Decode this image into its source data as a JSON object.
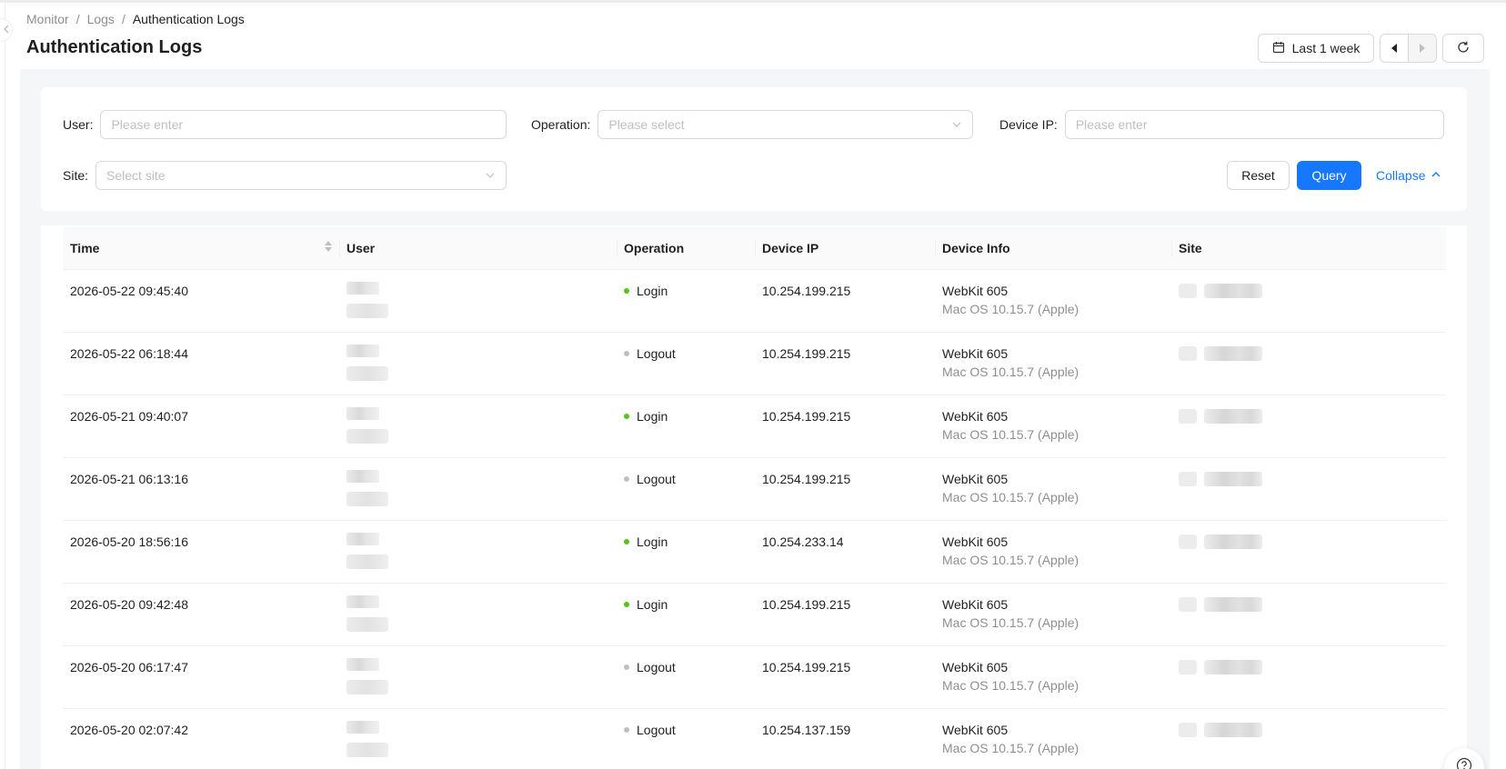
{
  "breadcrumb": {
    "items": [
      "Monitor",
      "Logs",
      "Authentication Logs"
    ],
    "separator": "/"
  },
  "page": {
    "title": "Authentication Logs"
  },
  "toolbar": {
    "range_label": "Last 1 week",
    "icons": [
      "calendar-icon",
      "caret-left-icon",
      "caret-right-icon",
      "reload-icon"
    ]
  },
  "filters": {
    "user": {
      "label": "User",
      "placeholder": "Please enter"
    },
    "operation": {
      "label": "Operation",
      "placeholder": "Please select"
    },
    "device_ip": {
      "label": "Device IP",
      "placeholder": "Please enter"
    },
    "site": {
      "label": "Site",
      "placeholder": "Select site"
    },
    "reset_label": "Reset",
    "query_label": "Query",
    "collapse_label": "Collapse"
  },
  "table": {
    "columns": {
      "time": "Time",
      "user": "User",
      "operation": "Operation",
      "device_ip": "Device IP",
      "device_info": "Device Info",
      "site": "Site"
    },
    "rows": [
      {
        "time": "2026-05-22 09:45:40",
        "operation": "Login",
        "device_ip": "10.254.199.215",
        "device_name": "WebKit 605",
        "device_os": "Mac OS 10.15.7 (Apple)"
      },
      {
        "time": "2026-05-22 06:18:44",
        "operation": "Logout",
        "device_ip": "10.254.199.215",
        "device_name": "WebKit 605",
        "device_os": "Mac OS 10.15.7 (Apple)"
      },
      {
        "time": "2026-05-21 09:40:07",
        "operation": "Login",
        "device_ip": "10.254.199.215",
        "device_name": "WebKit 605",
        "device_os": "Mac OS 10.15.7 (Apple)"
      },
      {
        "time": "2026-05-21 06:13:16",
        "operation": "Logout",
        "device_ip": "10.254.199.215",
        "device_name": "WebKit 605",
        "device_os": "Mac OS 10.15.7 (Apple)"
      },
      {
        "time": "2026-05-20 18:56:16",
        "operation": "Login",
        "device_ip": "10.254.233.14",
        "device_name": "WebKit 605",
        "device_os": "Mac OS 10.15.7 (Apple)"
      },
      {
        "time": "2026-05-20 09:42:48",
        "operation": "Login",
        "device_ip": "10.254.199.215",
        "device_name": "WebKit 605",
        "device_os": "Mac OS 10.15.7 (Apple)"
      },
      {
        "time": "2026-05-20 06:17:47",
        "operation": "Logout",
        "device_ip": "10.254.199.215",
        "device_name": "WebKit 605",
        "device_os": "Mac OS 10.15.7 (Apple)"
      },
      {
        "time": "2026-05-20 02:07:42",
        "operation": "Logout",
        "device_ip": "10.254.137.159",
        "device_name": "WebKit 605",
        "device_os": "Mac OS 10.15.7 (Apple)"
      }
    ]
  },
  "colors": {
    "primary": "#1677ff",
    "login_dot": "#52c41a",
    "logout_dot": "#bfbfbf",
    "page_bg": "#f5f6f8"
  }
}
